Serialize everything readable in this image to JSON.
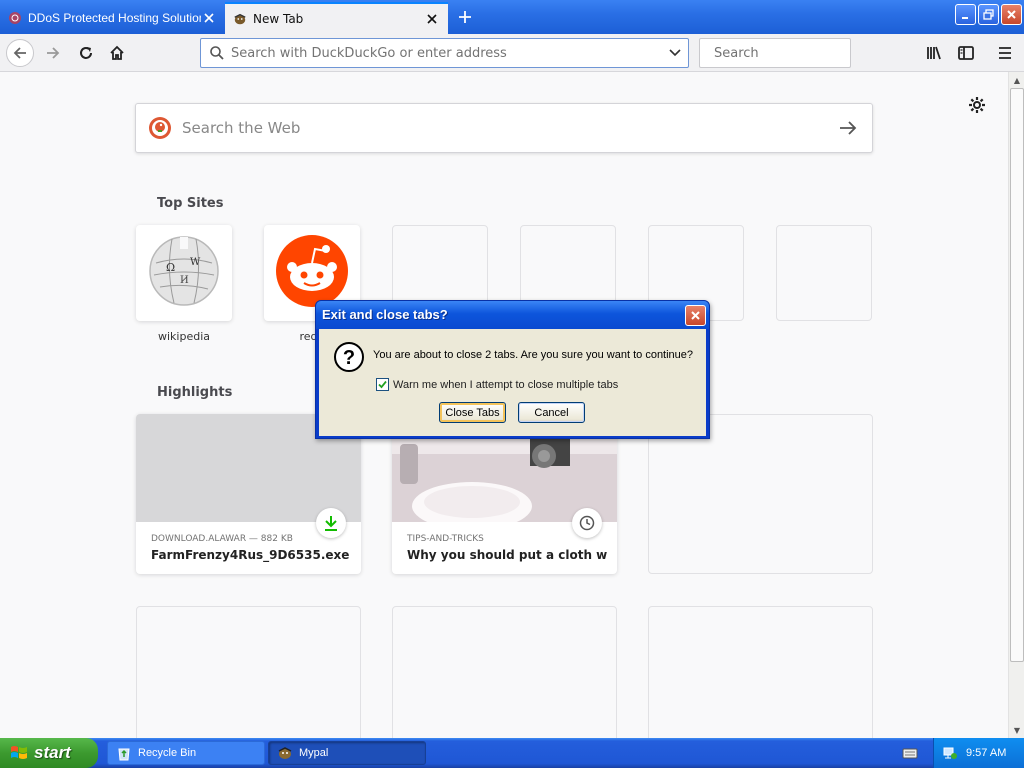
{
  "browser": {
    "tabs": [
      {
        "title": "DDoS Protected Hosting Solutions",
        "active": false
      },
      {
        "title": "New Tab",
        "active": true
      }
    ],
    "address_placeholder": "Search with DuckDuckGo or enter address",
    "search_placeholder": "Search"
  },
  "newtab": {
    "web_search_placeholder": "Search the Web",
    "top_sites_title": "Top Sites",
    "top_sites": [
      {
        "label": "wikipedia"
      },
      {
        "label": "redd"
      }
    ],
    "highlights_title": "Highlights",
    "highlights": [
      {
        "meta": "DOWNLOAD.ALAWAR — 882 KB",
        "title": "FarmFrenzy4Rus_9D6535.exe"
      },
      {
        "meta": "TIPS-AND-TRICKS",
        "title": "Why you should put a cloth with ..."
      }
    ]
  },
  "dialog": {
    "title": "Exit and close tabs?",
    "message": "You are about to close 2 tabs. Are you sure you want to continue?",
    "checkbox_label": "Warn me when I attempt to close multiple tabs",
    "checkbox_checked": true,
    "confirm_label": "Close Tabs",
    "cancel_label": "Cancel"
  },
  "taskbar": {
    "start_label": "start",
    "tasks": [
      {
        "label": "Recycle Bin"
      },
      {
        "label": "Mypal"
      }
    ],
    "clock": "9:57 AM"
  },
  "colors": {
    "xp_blue": "#245edc",
    "accent": "#0a84ff",
    "reddit": "#ff4500",
    "download_green": "#12bc00"
  }
}
